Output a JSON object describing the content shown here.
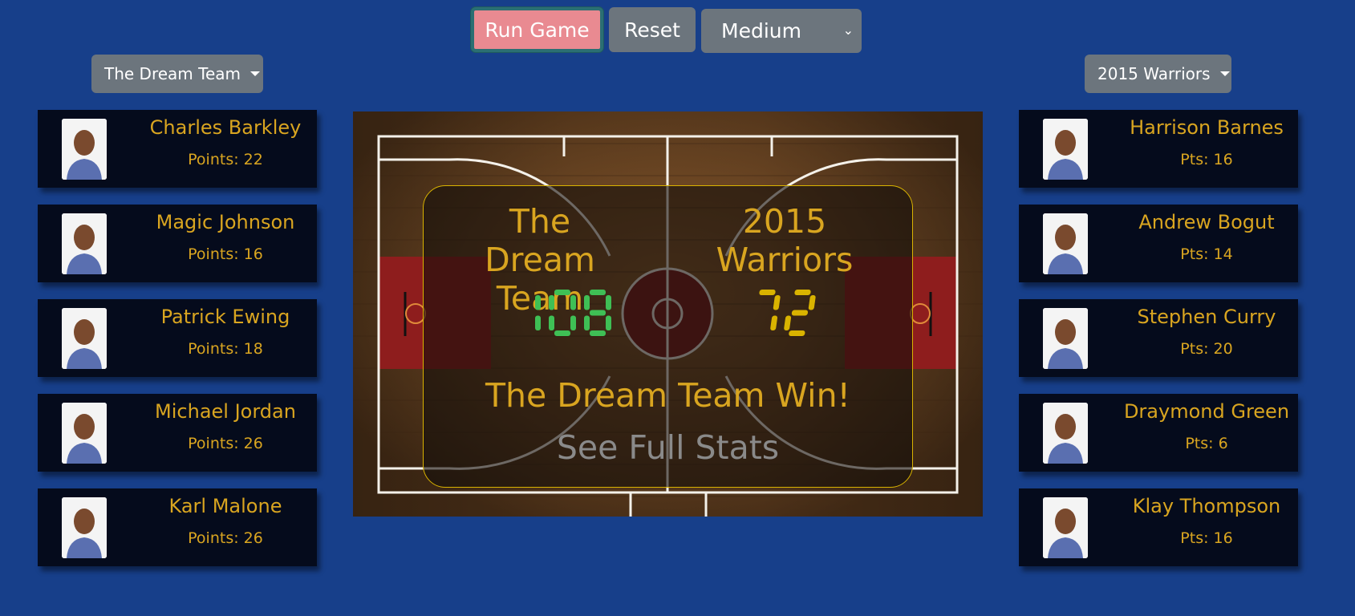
{
  "controls": {
    "run_label": "Run Game",
    "reset_label": "Reset",
    "difficulty": "Medium"
  },
  "left_team": {
    "dropdown_label": "The Dream Team",
    "players": [
      {
        "name": "Charles Barkley",
        "stat": "Points: 22"
      },
      {
        "name": "Magic Johnson",
        "stat": "Points: 16"
      },
      {
        "name": "Patrick Ewing",
        "stat": "Points: 18"
      },
      {
        "name": "Michael Jordan",
        "stat": "Points: 26"
      },
      {
        "name": "Karl Malone",
        "stat": "Points: 26"
      }
    ]
  },
  "right_team": {
    "dropdown_label": "2015 Warriors",
    "players": [
      {
        "name": "Harrison Barnes",
        "stat": "Pts: 16"
      },
      {
        "name": "Andrew Bogut",
        "stat": "Pts: 14"
      },
      {
        "name": "Stephen Curry",
        "stat": "Pts: 20"
      },
      {
        "name": "Draymond Green",
        "stat": "Pts: 6"
      },
      {
        "name": "Klay Thompson",
        "stat": "Pts: 16"
      }
    ]
  },
  "scoreboard": {
    "team1_name": "The Dream Team",
    "team2_name": "2015 Warriors",
    "team1_score": "108",
    "team2_score": "72",
    "result": "The Dream Team Win!",
    "stats_link": "See Full Stats"
  },
  "colors": {
    "background": "#173f8a",
    "gold": "#d9a520",
    "score1": "#3fbf55",
    "score2": "#d9b300"
  }
}
